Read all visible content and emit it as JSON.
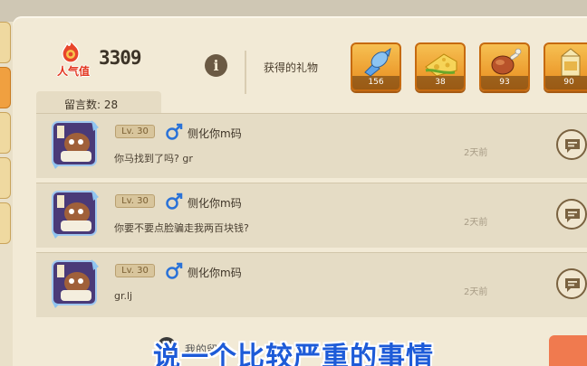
{
  "popularity": {
    "label": "人气值",
    "score": "3309"
  },
  "info_icon": "i",
  "gifts": {
    "label": "获得的礼物",
    "items": [
      {
        "name": "candy-icon",
        "count": "156"
      },
      {
        "name": "cheese-icon",
        "count": "38"
      },
      {
        "name": "drumstick-icon",
        "count": "93"
      },
      {
        "name": "milk-carton-icon",
        "count": "90"
      }
    ]
  },
  "messages": {
    "count_label": "留言数: 28",
    "items": [
      {
        "level": "Lv. 30",
        "nickname": "侧化你m码",
        "text": "你马找到了吗? gr",
        "time": "2天前"
      },
      {
        "level": "Lv. 30",
        "nickname": "侧化你m码",
        "text": "你要不要点脸骗走我两百块钱?",
        "time": "2天前"
      },
      {
        "level": "Lv. 30",
        "nickname": "侧化你m码",
        "text": "gr.lj",
        "time": "2天前"
      }
    ]
  },
  "bottom_peek": "我的留",
  "subtitle": "说一个比较严重的事情",
  "colors": {
    "accent_orange": "#e88a1c",
    "male_blue": "#2a72d8",
    "subtitle_blue": "#1d5bd8"
  }
}
